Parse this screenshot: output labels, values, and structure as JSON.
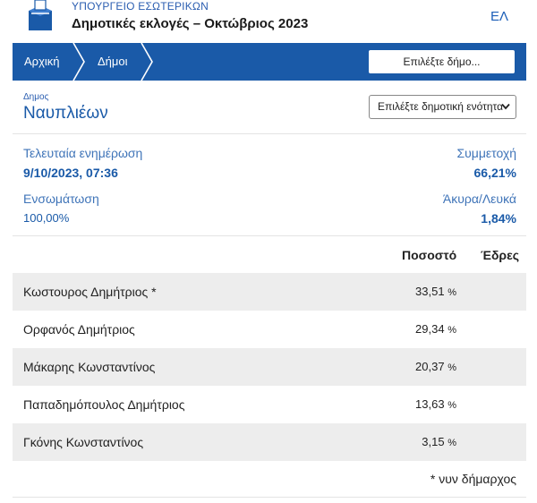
{
  "header": {
    "ministry": "ΥΠΟΥΡΓΕΙΟ ΕΣΩΤΕΡΙΚΩΝ",
    "election_title": "Δημοτικές εκλογές – Οκτώβριος 2023",
    "language": "ΕΛ",
    "logo_icon": "ballot-box-icon"
  },
  "nav": {
    "home": "Αρχική",
    "municipalities": "Δήμοι",
    "select_municipality": "Επιλέξτε δήμο..."
  },
  "municipality": {
    "label": "Δημος",
    "name": "Ναυπλιέων",
    "unit_select": "Επιλέξτε δημοτική ενότητα"
  },
  "stats": {
    "last_update_label": "Τελευταία ενημέρωση",
    "last_update_value": "9/10/2023, 07:36",
    "turnout_label": "Συμμετοχή",
    "turnout_value": "66,21%",
    "integration_label": "Ενσωμάτωση",
    "integration_value": "100,00%",
    "invalid_label": "Άκυρα/Λευκά",
    "invalid_value": "1,84%"
  },
  "table": {
    "col_percent": "Ποσοστό",
    "col_seats": "Έδρες",
    "rows": [
      {
        "candidate": "Κωστουρος Δημήτριος *",
        "percent": "33,51",
        "unit": "%"
      },
      {
        "candidate": "Ορφανός Δημήτριος",
        "percent": "29,34",
        "unit": "%"
      },
      {
        "candidate": "Μάκαρης Κωνσταντίνος",
        "percent": "20,37",
        "unit": "%"
      },
      {
        "candidate": "Παπαδημόπουλος Δημήτριος",
        "percent": "13,63",
        "unit": "%"
      },
      {
        "candidate": "Γκόνης Κωνσταντίνος",
        "percent": "3,15",
        "unit": "%"
      }
    ]
  },
  "footnote": "* νυν δήμαρχος",
  "colors": {
    "primary": "#1a5aa8",
    "link": "#3f74b8",
    "row_shade": "#ededed"
  }
}
